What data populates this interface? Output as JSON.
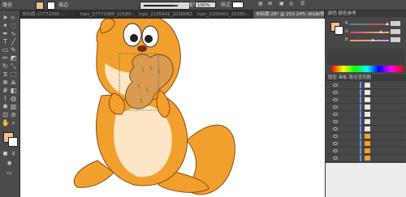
{
  "app": {
    "title": "图层"
  },
  "colors": {
    "accent": "#f3a32b",
    "fill_swatch": "#f4c08a",
    "fur": "#f2a02d",
    "belly": "#fde6c5",
    "nut": "#d99a52"
  },
  "topbar": {
    "label": "路径",
    "stroke_label": "描边",
    "stroke_pt": "等比",
    "opacity_label": "不透明度",
    "opacity_value": "100%",
    "style_label": "样式"
  },
  "tabs": [
    {
      "label": "未标题-27772980 ..."
    },
    {
      "label": "hpic_27772980_20180..."
    },
    {
      "label": "hpic_2105401_2018062..."
    },
    {
      "label": "hpic_2105401_20180..."
    },
    {
      "label": "未标题-28* @ 253.24% (RGB/预览)"
    }
  ],
  "color_panel": {
    "header": "颜色  颜色参考",
    "channels": [
      "R",
      "G",
      "B"
    ]
  },
  "layers_panel": {
    "header": "图层  画板  路径查找器"
  },
  "tools": [
    "selection-tool",
    "direct-selection-tool",
    "magic-wand-tool",
    "lasso-tool",
    "pen-tool",
    "curvature-tool",
    "type-tool",
    "line-tool",
    "rectangle-tool",
    "paintbrush-tool",
    "pencil-tool",
    "eraser-tool",
    "rotate-tool",
    "scale-tool",
    "width-tool",
    "free-transform-tool",
    "shape-builder-tool",
    "perspective-tool",
    "mesh-tool",
    "gradient-tool",
    "eyedropper-tool",
    "blend-tool",
    "symbol-sprayer-tool",
    "column-graph-tool",
    "artboard-tool",
    "slice-tool",
    "hand-tool",
    "zoom-tool"
  ]
}
